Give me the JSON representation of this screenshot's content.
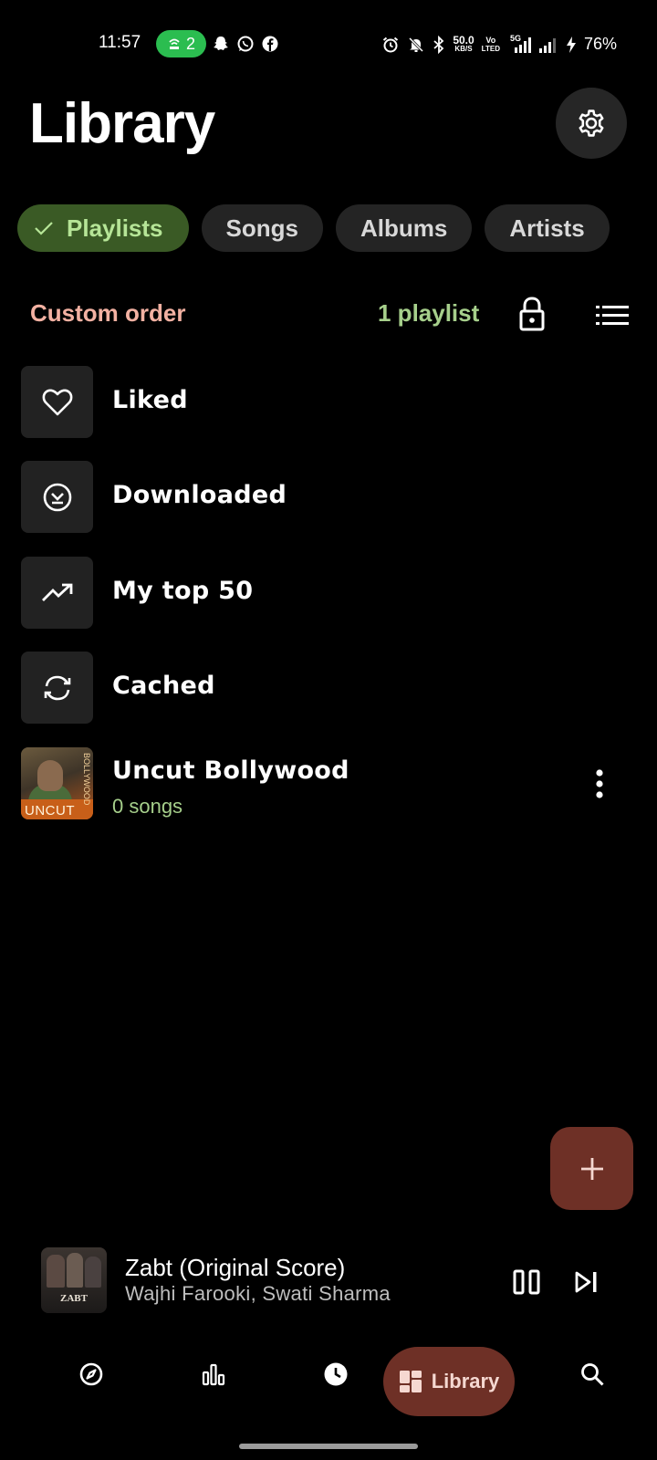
{
  "status_bar": {
    "time": "11:57",
    "hotspot_count": "2",
    "net_speed_value": "50.0",
    "net_speed_unit": "KB/S",
    "volte_top": "Vo",
    "volte_bottom": "LTED",
    "network": "5G",
    "battery": "76%"
  },
  "header": {
    "title": "Library"
  },
  "tabs": [
    {
      "label": "Playlists",
      "active": true
    },
    {
      "label": "Songs",
      "active": false
    },
    {
      "label": "Albums",
      "active": false
    },
    {
      "label": "Artists",
      "active": false
    }
  ],
  "sort": {
    "order_label": "Custom order",
    "count_label": "1 playlist"
  },
  "playlists": [
    {
      "title": "Liked",
      "icon": "heart-icon"
    },
    {
      "title": "Downloaded",
      "icon": "download-check-icon"
    },
    {
      "title": "My top 50",
      "icon": "trending-up-icon"
    },
    {
      "title": "Cached",
      "icon": "sync-icon"
    },
    {
      "title": "Uncut Bollywood",
      "subtitle": "0 songs",
      "cover_text": "UNCUT",
      "cover_vertical_text": "BOLLYWOOD",
      "icon": "playlist-cover"
    }
  ],
  "now_playing": {
    "title": "Zabt (Original Score)",
    "artist": "Wajhi Farooki, Swati Sharma",
    "cover_text": "ZABT"
  },
  "bottom_nav": {
    "items": [
      "explore-icon",
      "charts-icon",
      "history-icon",
      "library-icon",
      "search-icon"
    ],
    "active_label": "Library"
  },
  "colors": {
    "background": "#000000",
    "chip_active_bg": "#3a5a25",
    "chip_active_text": "#b6e597",
    "sort_label": "#f3b1a2",
    "count_label": "#a6cf8b",
    "accent": "#6e3026"
  }
}
